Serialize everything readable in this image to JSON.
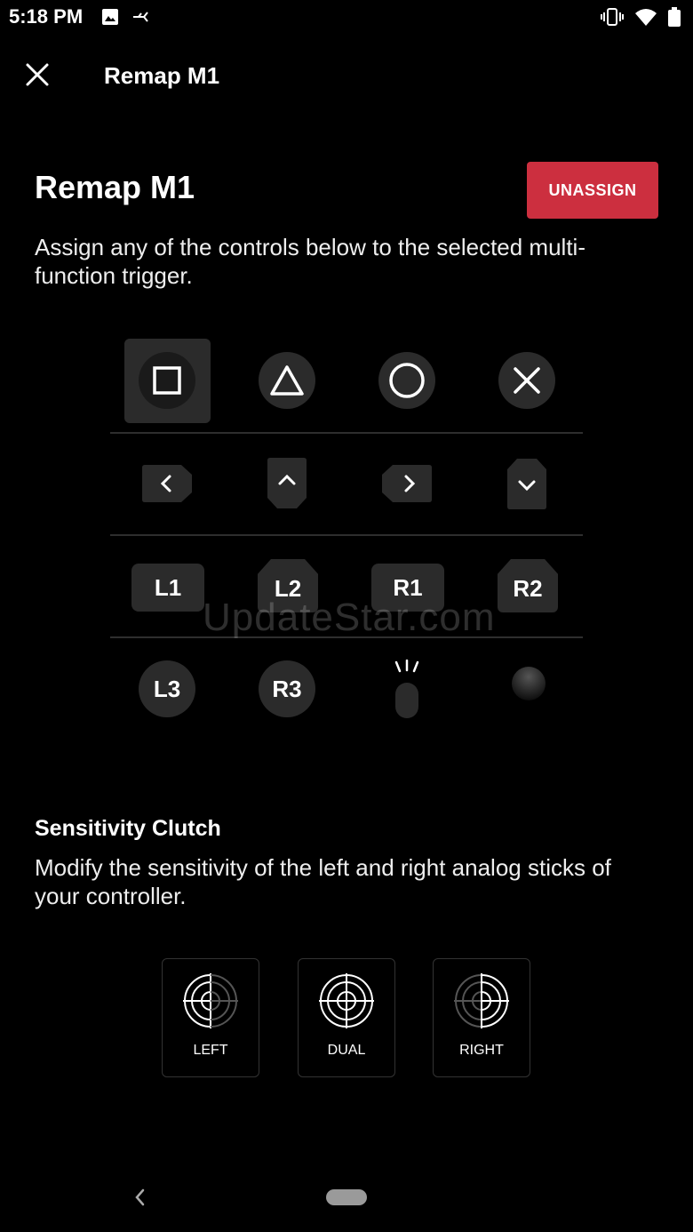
{
  "status_bar": {
    "time": "5:18 PM",
    "icons_left": [
      "image-icon",
      "usb-debug-icon"
    ],
    "icons_right": [
      "vibrate-icon",
      "wifi-icon",
      "battery-icon"
    ]
  },
  "app_bar": {
    "close_icon": "close-icon",
    "title": "Remap M1"
  },
  "header": {
    "heading": "Remap M1",
    "unassign_label": "UNASSIGN",
    "unassign_color": "#cc2f3f",
    "description": "Assign any of the controls below to the selected multi-function trigger."
  },
  "controls": {
    "face_buttons": [
      "square",
      "triangle",
      "circle",
      "cross"
    ],
    "selected": "square",
    "dpad": [
      "left",
      "up",
      "right",
      "down"
    ],
    "shoulders": [
      "L1",
      "L2",
      "R1",
      "R2"
    ],
    "sticks": [
      "L3",
      "R3"
    ],
    "extras": [
      "touchpad-icon",
      "ps-button-icon"
    ]
  },
  "sensitivity": {
    "title": "Sensitivity Clutch",
    "description": "Modify the sensitivity of the left and right analog sticks of your controller.",
    "options": [
      "LEFT",
      "DUAL",
      "RIGHT"
    ]
  },
  "watermark": "UpdateStar.com",
  "nav_bar": {
    "back_icon": "nav-back-icon",
    "home_icon": "nav-home-pill"
  }
}
